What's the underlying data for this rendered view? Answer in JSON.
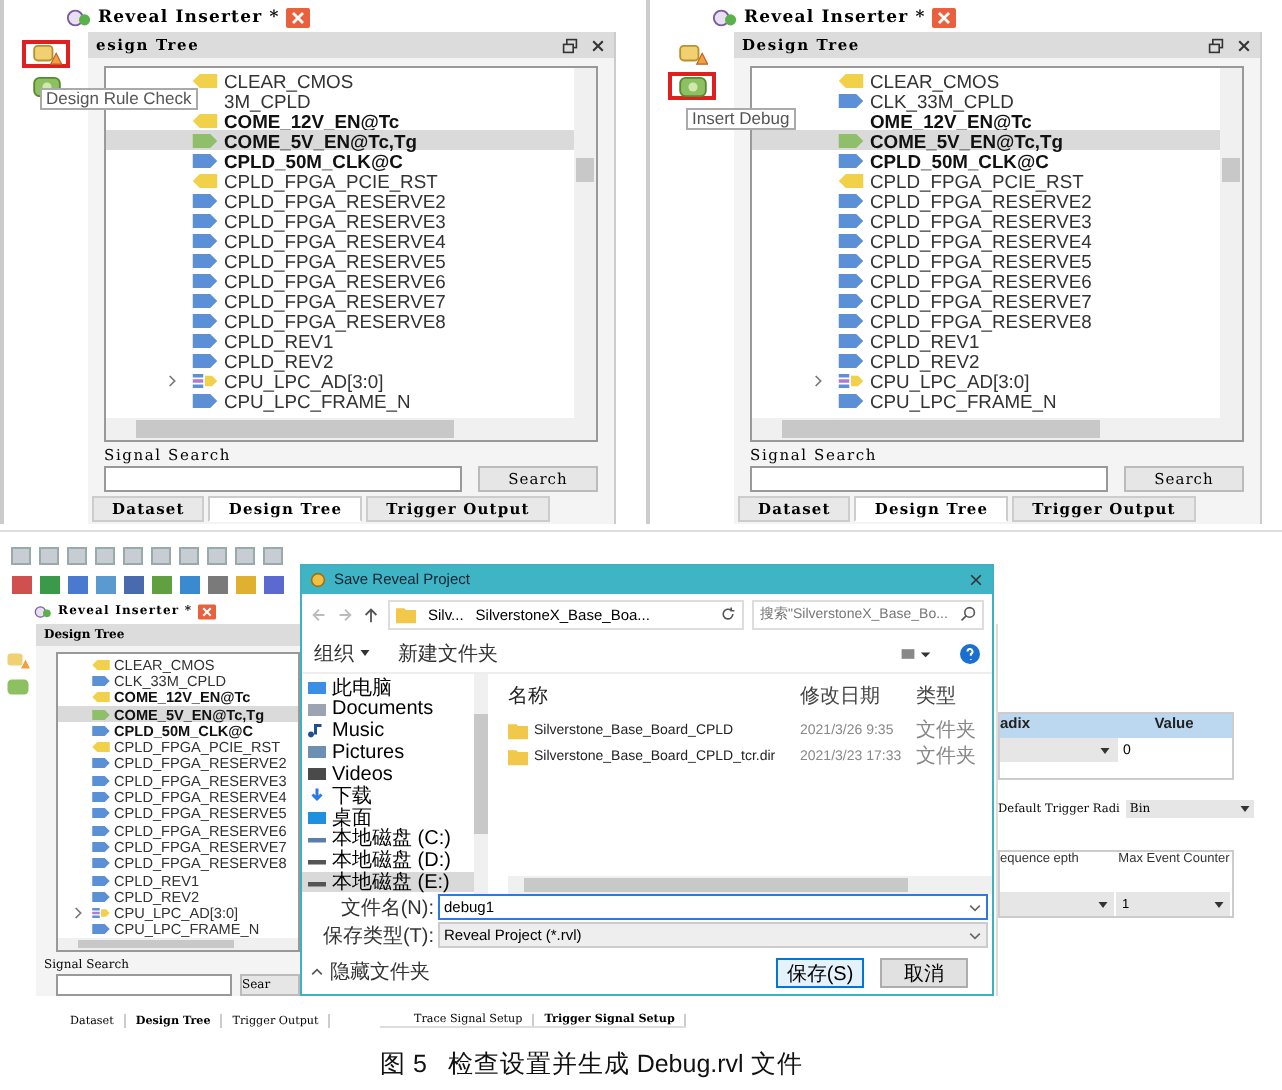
{
  "top_panels": [
    {
      "tab": {
        "title": "Reveal Inserter *"
      },
      "tools": [
        {
          "kind": "check",
          "selected": true
        },
        {
          "kind": "debug",
          "selected": false
        }
      ],
      "tooltip": "Design Rule Check",
      "header": "esign Tree",
      "signals": [
        {
          "name": "CLEAR_CMOS",
          "kind": "output",
          "bold": false,
          "selected": false
        },
        {
          "name": "3M_CPLD",
          "bold": false,
          "selected": false
        },
        {
          "name": "COME_12V_EN@Tc",
          "kind": "output",
          "bold": true,
          "selected": false
        },
        {
          "name": "COME_5V_EN@Tc,Tg",
          "kind": "mixed",
          "bold": true,
          "selected": true
        },
        {
          "name": "CPLD_50M_CLK@C",
          "kind": "input",
          "bold": true,
          "selected": false
        },
        {
          "name": "CPLD_FPGA_PCIE_RST",
          "kind": "output",
          "bold": false,
          "selected": false
        },
        {
          "name": "CPLD_FPGA_RESERVE2",
          "kind": "input",
          "bold": false,
          "selected": false
        },
        {
          "name": "CPLD_FPGA_RESERVE3",
          "kind": "input",
          "bold": false,
          "selected": false
        },
        {
          "name": "CPLD_FPGA_RESERVE4",
          "kind": "input",
          "bold": false,
          "selected": false
        },
        {
          "name": "CPLD_FPGA_RESERVE5",
          "kind": "input",
          "bold": false,
          "selected": false
        },
        {
          "name": "CPLD_FPGA_RESERVE6",
          "kind": "input",
          "bold": false,
          "selected": false
        },
        {
          "name": "CPLD_FPGA_RESERVE7",
          "kind": "input",
          "bold": false,
          "selected": false
        },
        {
          "name": "CPLD_FPGA_RESERVE8",
          "kind": "input",
          "bold": false,
          "selected": false
        },
        {
          "name": "CPLD_REV1",
          "kind": "input",
          "bold": false,
          "selected": false
        },
        {
          "name": "CPLD_REV2",
          "kind": "input",
          "bold": false,
          "selected": false
        },
        {
          "name": "CPU_LPC_AD[3:0]",
          "kind": "bus",
          "bold": false,
          "selected": false
        },
        {
          "name": "CPU_LPC_FRAME_N",
          "kind": "input",
          "bold": false,
          "selected": false
        }
      ],
      "search": {
        "label": "Signal Search",
        "button": "Search"
      },
      "bottom_tabs": [
        {
          "label": "Dataset",
          "selected": false
        },
        {
          "label": "Design Tree",
          "selected": true
        },
        {
          "label": "Trigger Output",
          "selected": false
        }
      ]
    },
    {
      "tab": {
        "title": "Reveal Inserter *"
      },
      "tools": [
        {
          "kind": "check",
          "selected": false
        },
        {
          "kind": "debug",
          "selected": true
        }
      ],
      "tooltip": "Insert Debug",
      "header": "Design Tree",
      "signals": [
        {
          "name": "CLEAR_CMOS",
          "kind": "output",
          "bold": false,
          "selected": false
        },
        {
          "name": "CLK_33M_CPLD",
          "kind": "input",
          "bold": false,
          "selected": false
        },
        {
          "name": "OME_12V_EN@Tc",
          "bold": true,
          "selected": false
        },
        {
          "name": "COME_5V_EN@Tc,Tg",
          "kind": "mixed",
          "bold": true,
          "selected": true
        },
        {
          "name": "CPLD_50M_CLK@C",
          "kind": "input",
          "bold": true,
          "selected": false
        },
        {
          "name": "CPLD_FPGA_PCIE_RST",
          "kind": "output",
          "bold": false,
          "selected": false
        },
        {
          "name": "CPLD_FPGA_RESERVE2",
          "kind": "input",
          "bold": false,
          "selected": false
        },
        {
          "name": "CPLD_FPGA_RESERVE3",
          "kind": "input",
          "bold": false,
          "selected": false
        },
        {
          "name": "CPLD_FPGA_RESERVE4",
          "kind": "input",
          "bold": false,
          "selected": false
        },
        {
          "name": "CPLD_FPGA_RESERVE5",
          "kind": "input",
          "bold": false,
          "selected": false
        },
        {
          "name": "CPLD_FPGA_RESERVE6",
          "kind": "input",
          "bold": false,
          "selected": false
        },
        {
          "name": "CPLD_FPGA_RESERVE7",
          "kind": "input",
          "bold": false,
          "selected": false
        },
        {
          "name": "CPLD_FPGA_RESERVE8",
          "kind": "input",
          "bold": false,
          "selected": false
        },
        {
          "name": "CPLD_REV1",
          "kind": "input",
          "bold": false,
          "selected": false
        },
        {
          "name": "CPLD_REV2",
          "kind": "input",
          "bold": false,
          "selected": false
        },
        {
          "name": "CPU_LPC_AD[3:0]",
          "kind": "bus",
          "bold": false,
          "selected": false
        },
        {
          "name": "CPU_LPC_FRAME_N",
          "kind": "input",
          "bold": false,
          "selected": false
        }
      ],
      "search": {
        "label": "Signal Search",
        "button": "Search"
      },
      "bottom_tabs": [
        {
          "label": "Dataset",
          "selected": false
        },
        {
          "label": "Design Tree",
          "selected": true
        },
        {
          "label": "Trigger Output",
          "selected": false
        }
      ]
    }
  ],
  "main_window": {
    "tab": {
      "title": "Reveal Inserter *"
    },
    "header": "Design Tree",
    "signals": [
      {
        "name": "CLEAR_CMOS",
        "kind": "output",
        "bold": false,
        "selected": false
      },
      {
        "name": "CLK_33M_CPLD",
        "kind": "input",
        "bold": false,
        "selected": false
      },
      {
        "name": "COME_12V_EN@Tc",
        "kind": "output",
        "bold": true,
        "selected": false
      },
      {
        "name": "COME_5V_EN@Tc,Tg",
        "kind": "mixed",
        "bold": true,
        "selected": true
      },
      {
        "name": "CPLD_50M_CLK@C",
        "kind": "input",
        "bold": true,
        "selected": false
      },
      {
        "name": "CPLD_FPGA_PCIE_RST",
        "kind": "output",
        "bold": false,
        "selected": false
      },
      {
        "name": "CPLD_FPGA_RESERVE2",
        "kind": "input",
        "bold": false,
        "selected": false
      },
      {
        "name": "CPLD_FPGA_RESERVE3",
        "kind": "input",
        "bold": false,
        "selected": false
      },
      {
        "name": "CPLD_FPGA_RESERVE4",
        "kind": "input",
        "bold": false,
        "selected": false
      },
      {
        "name": "CPLD_FPGA_RESERVE5",
        "kind": "input",
        "bold": false,
        "selected": false
      },
      {
        "name": "CPLD_FPGA_RESERVE6",
        "kind": "input",
        "bold": false,
        "selected": false
      },
      {
        "name": "CPLD_FPGA_RESERVE7",
        "kind": "input",
        "bold": false,
        "selected": false
      },
      {
        "name": "CPLD_FPGA_RESERVE8",
        "kind": "input",
        "bold": false,
        "selected": false
      },
      {
        "name": "CPLD_REV1",
        "kind": "input",
        "bold": false,
        "selected": false
      },
      {
        "name": "CPLD_REV2",
        "kind": "input",
        "bold": false,
        "selected": false
      },
      {
        "name": "CPU_LPC_AD[3:0]",
        "kind": "bus",
        "bold": false,
        "selected": false
      },
      {
        "name": "CPU_LPC_FRAME_N",
        "kind": "input",
        "bold": false,
        "selected": false
      }
    ],
    "search": {
      "label": "Signal Search",
      "button": "Sear"
    },
    "left_tabs": [
      {
        "label": "Dataset",
        "selected": false
      },
      {
        "label": "Design Tree",
        "selected": true
      },
      {
        "label": "Trigger Output",
        "selected": false
      }
    ],
    "right_tabs": [
      {
        "label": "Trace Signal Setup",
        "selected": false
      },
      {
        "label": "Trigger Signal Setup",
        "selected": true
      }
    ],
    "radix_table": {
      "columns": [
        "adix",
        "Value"
      ],
      "value": "0"
    },
    "default_trigger_radix": {
      "label": "Default Trigger Radi",
      "value": "Bin"
    },
    "event_table": {
      "columns": [
        "equence epth",
        "Max Event Counter"
      ],
      "value": "1"
    }
  },
  "dialog": {
    "title": "Save Reveal Project",
    "breadcrumb": [
      "Silv...",
      "SilverstoneX_Base_Boa..."
    ],
    "search_placeholder": "搜索\"SilverstoneX_Base_Bo...",
    "organize": "组织",
    "new_folder": "新建文件夹",
    "nav": [
      {
        "label": "此电脑",
        "kind": "pc",
        "selected": false
      },
      {
        "label": "Documents",
        "kind": "doc",
        "selected": false
      },
      {
        "label": "Music",
        "kind": "music",
        "selected": false
      },
      {
        "label": "Pictures",
        "kind": "pictures",
        "selected": false
      },
      {
        "label": "Videos",
        "kind": "videos",
        "selected": false
      },
      {
        "label": "下载",
        "kind": "download",
        "selected": false
      },
      {
        "label": "桌面",
        "kind": "desktop",
        "selected": false
      },
      {
        "label": "本地磁盘 (C:)",
        "kind": "system_drive",
        "selected": false
      },
      {
        "label": "本地磁盘 (D:)",
        "kind": "drive",
        "selected": false
      },
      {
        "label": "本地磁盘 (E:)",
        "kind": "drive",
        "selected": true
      }
    ],
    "columns": [
      "名称",
      "修改日期",
      "类型"
    ],
    "files": [
      {
        "name": "Silverstone_Base_Board_CPLD",
        "date": "2021/3/26 9:35",
        "type": "文件夹"
      },
      {
        "name": "Silverstone_Base_Board_CPLD_tcr.dir",
        "date": "2021/3/23 17:33",
        "type": "文件夹"
      }
    ],
    "filename": {
      "label": "文件名(N):",
      "value": "debug1"
    },
    "filetype": {
      "label": "保存类型(T):",
      "value": "Reveal Project (*.rvl)"
    },
    "hide_folders": "隐藏文件夹",
    "buttons": [
      {
        "label": "保存(S)",
        "kind": "primary"
      },
      {
        "label": "取消",
        "kind": "normal"
      }
    ]
  },
  "caption": "图 5   检查设置并生成 Debug.rvl 文件"
}
